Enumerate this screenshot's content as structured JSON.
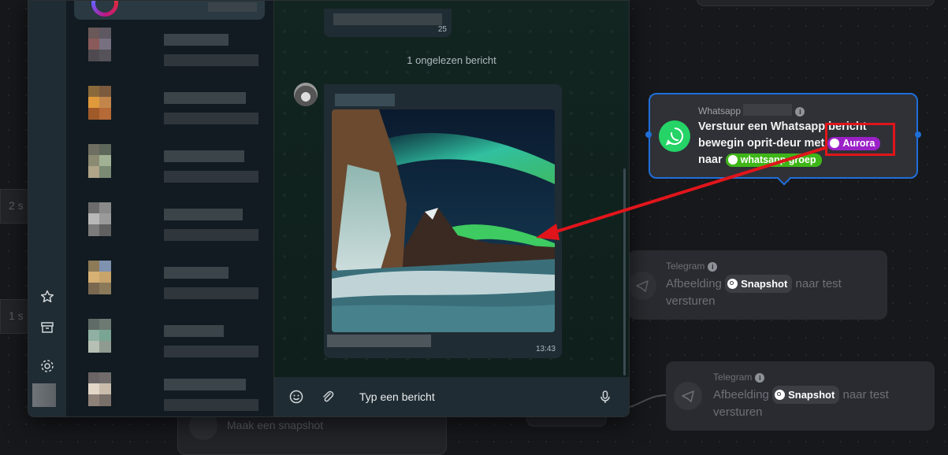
{
  "chat": {
    "unread_label": "1 ongelezen bericht",
    "top_bubble_time": "25",
    "message_time": "13:43",
    "composer_placeholder": "Typ een bericht"
  },
  "left_bg_labels": [
    "2 s",
    "1 s"
  ],
  "bg_nodes": {
    "snapshot_label": "Maak een snapshot"
  },
  "whatsapp_node": {
    "subtitle": "Whatsapp",
    "line1": "Verstuur een Whatsapp bericht",
    "line2_prefix": "bewegin oprit-deur met",
    "tag_aurora": "Aurora",
    "line3_prefix": "naar",
    "tag_group": "whatsapp groep"
  },
  "telegram_node_1": {
    "title": "Telegram",
    "text_prefix": "Afbeelding",
    "tag": "Snapshot",
    "text_suffix": "naar test",
    "text_line2": "versturen"
  },
  "telegram_node_2": {
    "title": "Telegram",
    "text_prefix": "Afbeelding",
    "tag": "Snapshot",
    "text_suffix": "naar test",
    "text_line2": "versturen"
  },
  "icons": {
    "rail": [
      "star-icon",
      "archive-icon",
      "gear-icon"
    ],
    "composer": [
      "emoji-icon",
      "paperclip-icon",
      "microphone-icon"
    ]
  },
  "colors": {
    "highlight": "#e0151b",
    "selected_node_border": "#1f6fd9",
    "whatsapp_green": "#25d366",
    "aurora_tag": "#9b21c7",
    "group_tag": "#3fb618"
  }
}
